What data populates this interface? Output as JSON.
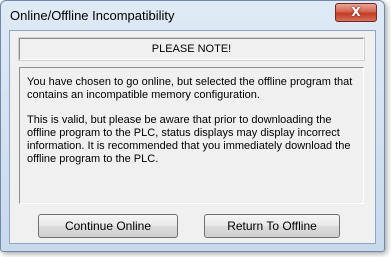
{
  "window": {
    "title": "Online/Offline Incompatibility",
    "close_symbol": "X",
    "close_icon": "close-icon"
  },
  "note": {
    "heading": "PLEASE NOTE!"
  },
  "message": {
    "paragraph1": "You have chosen to go online, but selected the offline program that contains an incompatible memory configuration.",
    "paragraph2": "This is valid, but please be aware that prior to downloading the offline program to the PLC, status displays may display incorrect information. It is recommended that you immediately download the offline program to the PLC."
  },
  "buttons": {
    "continue_label": "Continue Online",
    "return_label": "Return To Offline"
  }
}
